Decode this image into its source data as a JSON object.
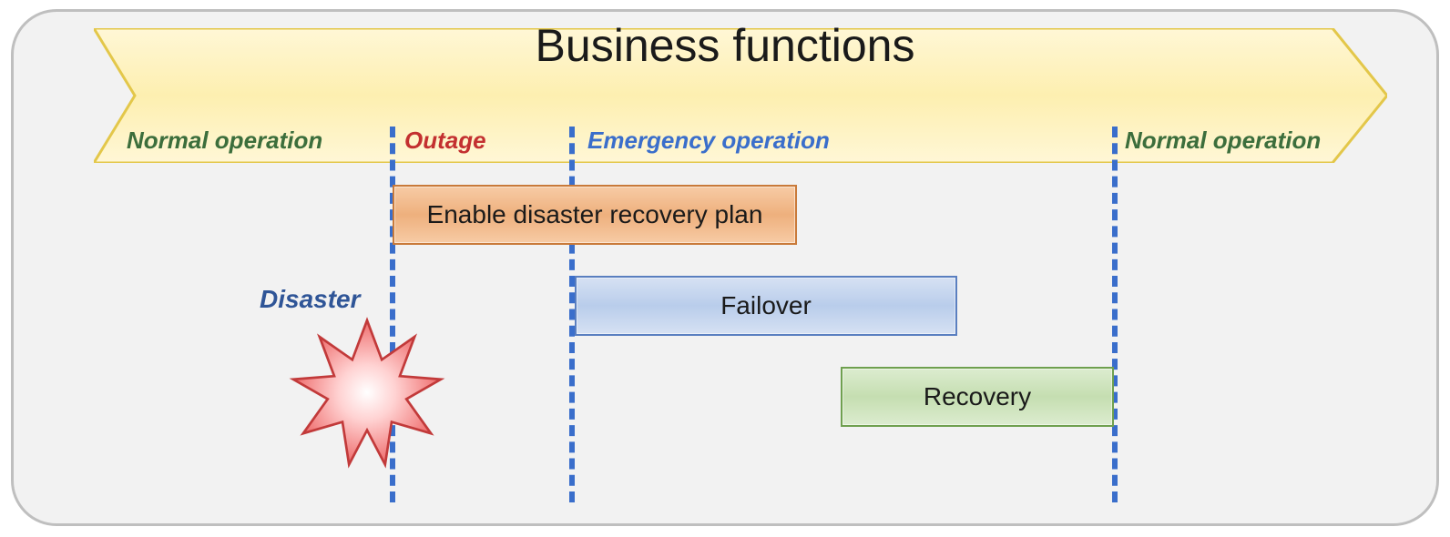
{
  "banner": {
    "title": "Business functions"
  },
  "phases": {
    "normal1": "Normal operation",
    "outage": "Outage",
    "emergency": "Emergency operation",
    "normal2": "Normal operation"
  },
  "boxes": {
    "dr_plan": "Enable disaster recovery plan",
    "failover": "Failover",
    "recovery": "Recovery"
  },
  "disaster_label": "Disaster"
}
